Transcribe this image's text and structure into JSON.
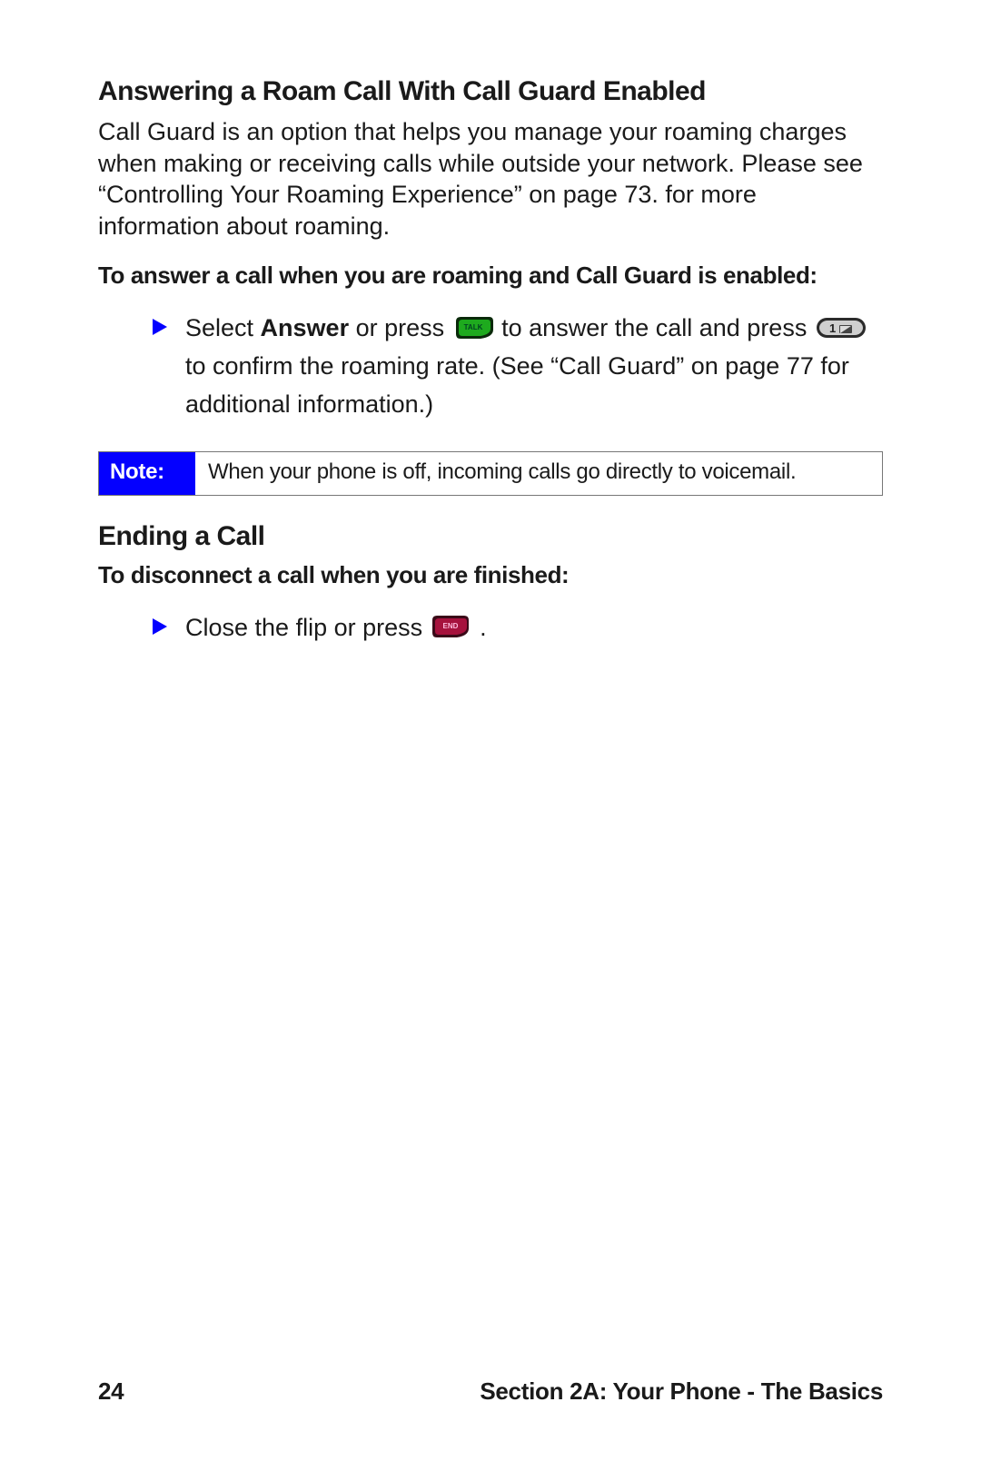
{
  "s1": {
    "heading": "Answering a Roam Call With Call Guard Enabled",
    "para": "Call Guard is an option that helps you manage your roaming charges when making or receiving calls while outside your network. Please see “Controlling Your Roaming Experience” on page 73. for more information about roaming.",
    "lead": "To answer a call when you are roaming and Call Guard is enabled:",
    "bullet": {
      "a": "Select ",
      "answer": "Answer",
      "b": " or press ",
      "talk_key": "TALK",
      "c": " to answer the call and press ",
      "one_key": "1",
      "d": " to confirm the roaming rate. (See “Call Guard” on page 77 for additional information.)"
    }
  },
  "note": {
    "label": "Note:",
    "text": "When your phone is off, incoming calls go directly to voicemail."
  },
  "s2": {
    "heading": "Ending a Call",
    "lead": "To disconnect a call when you are finished:",
    "bullet": {
      "a": "Close the flip or press ",
      "end_key": "END",
      "b": " ."
    }
  },
  "footer": {
    "page": "24",
    "section": "Section 2A: Your Phone - The Basics"
  }
}
